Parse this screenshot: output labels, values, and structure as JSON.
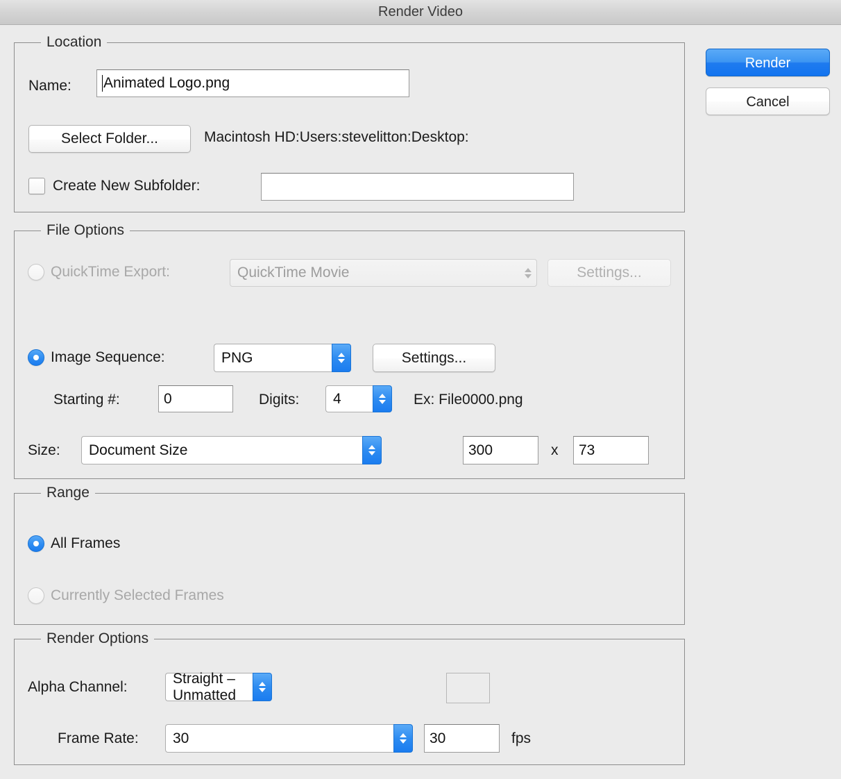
{
  "window": {
    "title": "Render Video"
  },
  "actions": {
    "render_label": "Render",
    "cancel_label": "Cancel"
  },
  "location": {
    "legend": "Location",
    "name_label": "Name:",
    "name_value": "Animated Logo.png",
    "select_folder_label": "Select Folder...",
    "folder_path": "Macintosh HD:Users:stevelitton:Desktop:",
    "create_subfolder_label": "Create New Subfolder:",
    "create_subfolder_checked": false,
    "subfolder_value": ""
  },
  "file_options": {
    "legend": "File Options",
    "quicktime": {
      "radio_label": "QuickTime Export:",
      "selected": false,
      "enabled": false,
      "format_value": "QuickTime Movie",
      "settings_label": "Settings..."
    },
    "image_sequence": {
      "radio_label": "Image Sequence:",
      "selected": true,
      "format_value": "PNG",
      "settings_label": "Settings...",
      "starting_label": "Starting #:",
      "starting_value": "0",
      "digits_label": "Digits:",
      "digits_value": "4",
      "example_label": "Ex: File0000.png"
    },
    "size": {
      "label": "Size:",
      "preset_value": "Document Size",
      "width_value": "300",
      "separator": "x",
      "height_value": "73"
    }
  },
  "range": {
    "legend": "Range",
    "all_frames_label": "All Frames",
    "all_frames_selected": true,
    "selected_frames_label": "Currently Selected Frames",
    "selected_frames_enabled": false
  },
  "render_options": {
    "legend": "Render Options",
    "alpha_label": "Alpha Channel:",
    "alpha_value": "Straight – Unmatted",
    "matte_value": "",
    "frame_rate_label": "Frame Rate:",
    "frame_rate_value": "30",
    "frame_rate_number": "30",
    "fps_label": "fps"
  },
  "colors": {
    "accent": "#1b7cef",
    "dialog_bg": "#ebebeb",
    "titlebar_top": "#e3e3e3",
    "titlebar_bottom": "#c9c9c9",
    "panel_border": "#8d8d8d",
    "disabled_text": "#a8a8a8"
  }
}
